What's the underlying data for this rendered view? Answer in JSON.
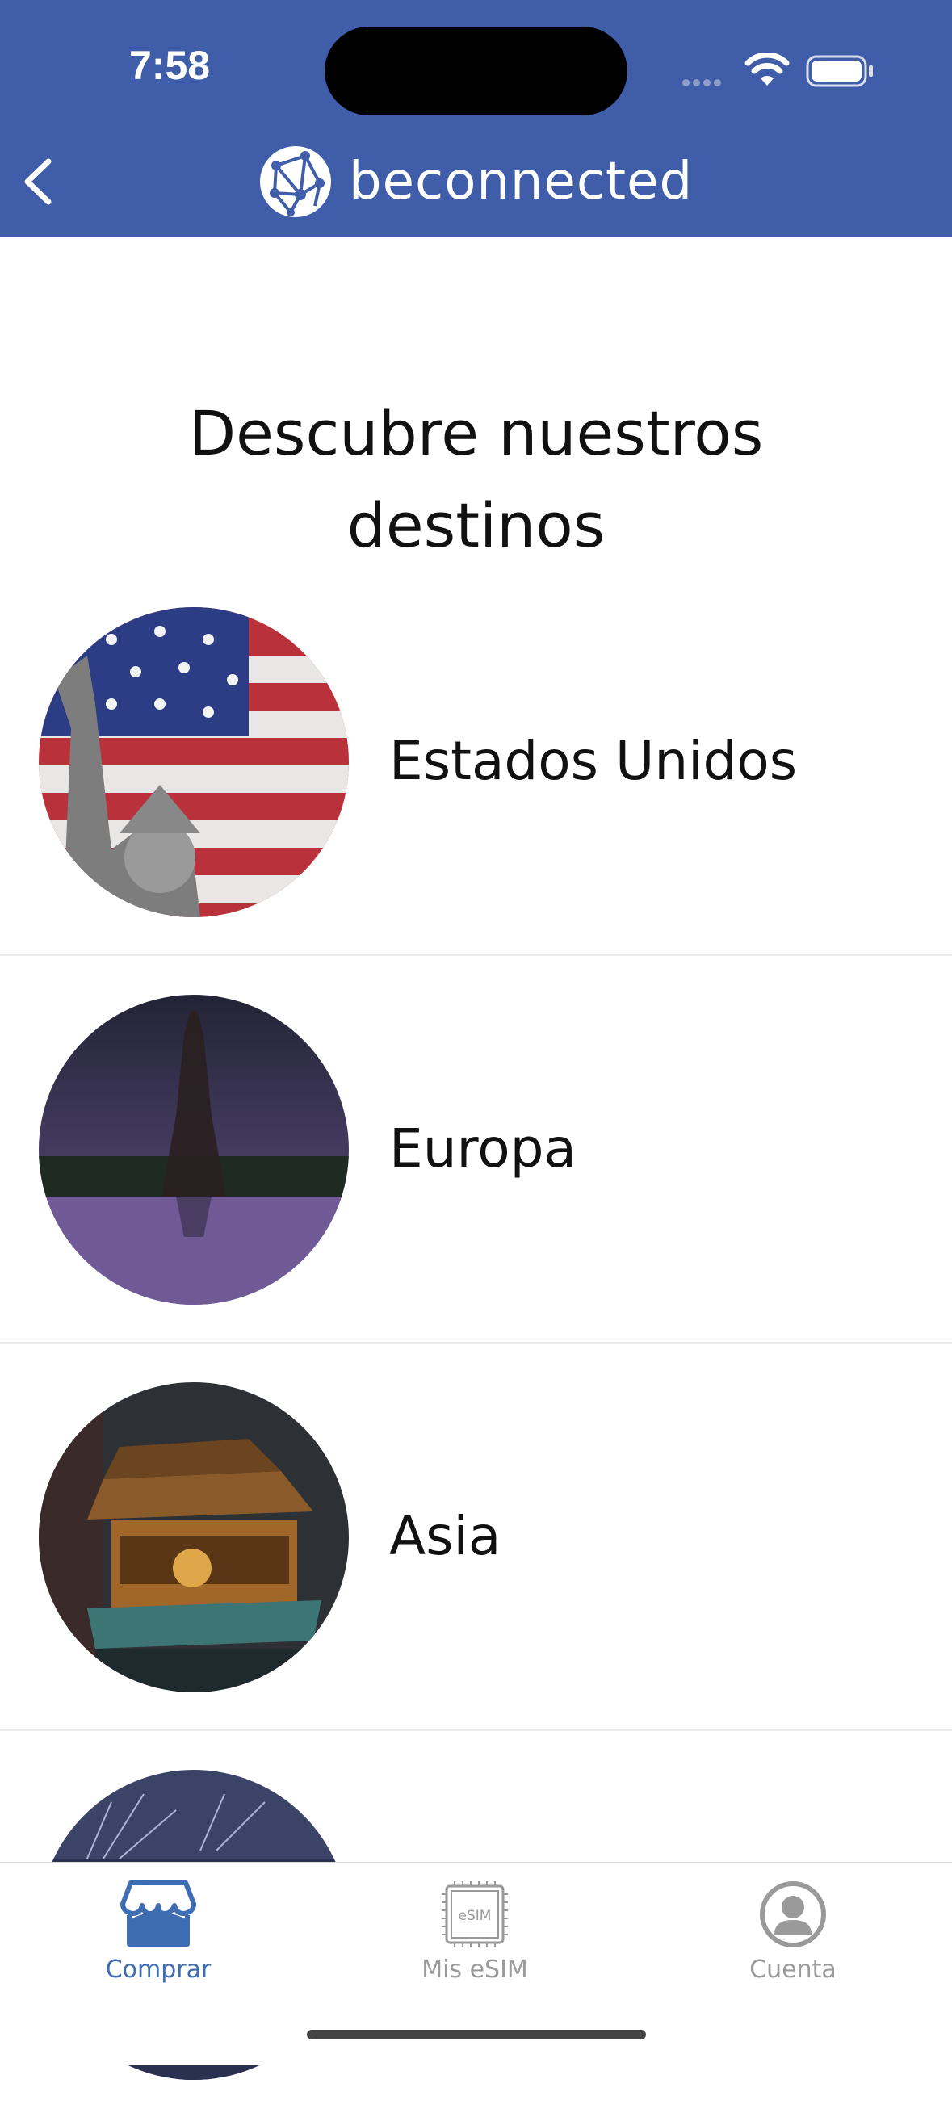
{
  "status_bar": {
    "time": "7:58"
  },
  "header": {
    "brand": "beconnected"
  },
  "page": {
    "title_line1": "Descubre nuestros",
    "title_line2": "destinos"
  },
  "destinations": [
    {
      "name": "Estados Unidos",
      "image": "statue-of-liberty-flag"
    },
    {
      "name": "Europa",
      "image": "eiffel-tower"
    },
    {
      "name": "Asia",
      "image": "asian-temple"
    },
    {
      "name": "",
      "image": "city-fireworks"
    }
  ],
  "tabs": [
    {
      "label": "Comprar",
      "icon": "store-icon",
      "active": true
    },
    {
      "label": "Mis eSIM",
      "icon": "esim-chip-icon",
      "active": false
    },
    {
      "label": "Cuenta",
      "icon": "account-icon",
      "active": false
    }
  ],
  "esim_chip_text": "eSIM",
  "colors": {
    "header": "#3f5da8",
    "active_tab": "#3f6db3",
    "inactive_tab": "#9a9a9a"
  }
}
